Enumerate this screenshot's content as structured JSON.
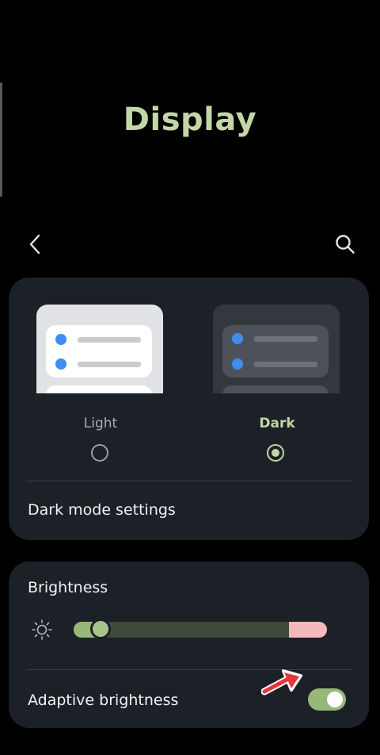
{
  "header": {
    "title": "Display"
  },
  "theme": {
    "light_label": "Light",
    "dark_label": "Dark",
    "selected": "Dark",
    "dark_mode_settings_label": "Dark mode settings"
  },
  "brightness": {
    "label": "Brightness",
    "level": 0.08,
    "adaptive_label": "Adaptive brightness",
    "adaptive_enabled": true
  },
  "icons": {
    "back": "chevron-left-icon",
    "search": "search-icon",
    "brightness": "sun-icon",
    "annotation": "red-arrow-annotation"
  },
  "colors": {
    "accent": "#c2d6a8",
    "card": "#1c2027",
    "slider_fill": "#98b878",
    "slider_extra": "#f4b9bd",
    "radio_blue": "#3d8ef0"
  }
}
